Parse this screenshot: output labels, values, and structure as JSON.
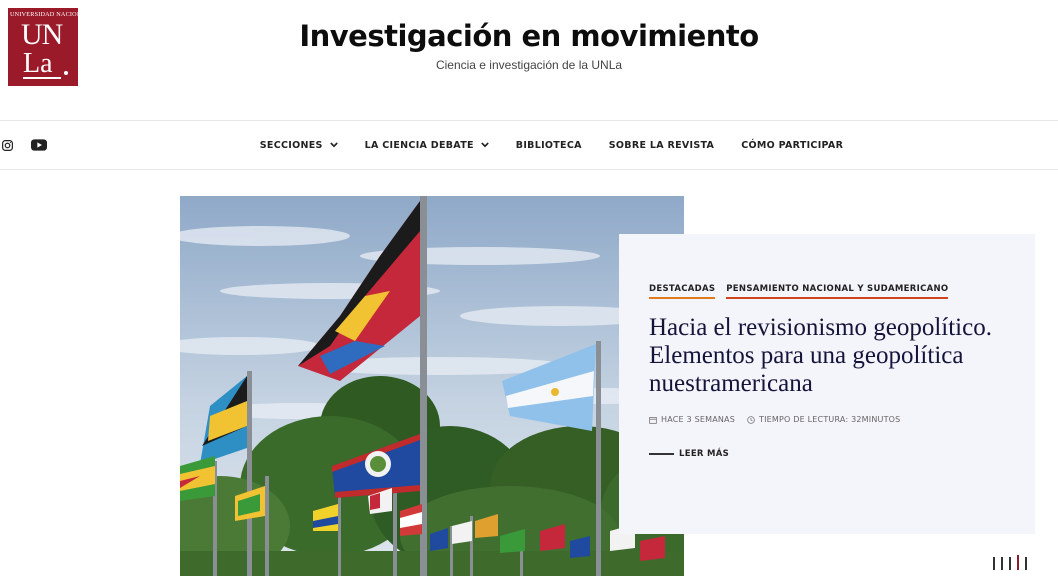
{
  "logo": {
    "arc_text": "UNIVERSIDAD NACIONAL DE LANÚS",
    "line1": "UN",
    "line2": "La",
    "color": "#9b1a2a"
  },
  "header": {
    "title": "Investigación en movimiento",
    "tagline": "Ciencia e investigación de la UNLa"
  },
  "social": [
    {
      "name": "instagram-icon"
    },
    {
      "name": "youtube-icon"
    }
  ],
  "nav": {
    "items": [
      {
        "label": "SECCIONES",
        "dropdown": true
      },
      {
        "label": "LA CIENCIA DEBATE",
        "dropdown": true
      },
      {
        "label": "BIBLIOTECA",
        "dropdown": false
      },
      {
        "label": "SOBRE LA REVISTA",
        "dropdown": false
      },
      {
        "label": "CÓMO PARTICIPAR",
        "dropdown": false
      }
    ]
  },
  "featured": {
    "categories": [
      "DESTACADAS",
      "PENSAMIENTO NACIONAL Y SUDAMERICANO"
    ],
    "title": "Hacia el revisionismo geopolítico. Elementos para una geopolítica nuestramericana",
    "date": "HACE 3 SEMANAS",
    "reading_time": "TIEMPO DE LECTURA: 32MINUTOS",
    "read_more": "LEER MÁS",
    "accent_colors": [
      "#e07a1a",
      "#d1451c"
    ]
  },
  "slider": {
    "count": 5,
    "active_index": 3
  }
}
